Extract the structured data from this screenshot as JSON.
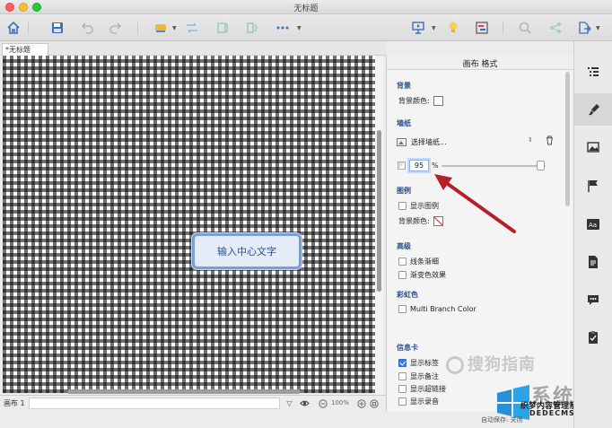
{
  "window": {
    "title": "无标题"
  },
  "tabs": [
    {
      "label": "*无标题"
    }
  ],
  "canvas": {
    "central_topic": "输入中心文字"
  },
  "status": {
    "sheet_label": "画布 1",
    "zoom": "100%"
  },
  "panel": {
    "title": "画布 格式",
    "background": {
      "section": "背景",
      "color_label": "背景颜色:"
    },
    "wallpaper": {
      "section": "墙纸",
      "select_label": "选择墙纸...",
      "opacity_value": "95",
      "opacity_unit": "%",
      "opacity_level": 0.95
    },
    "legend": {
      "section": "图例",
      "show_legend": "显示图例",
      "color_label": "背景颜色:"
    },
    "advanced": {
      "section": "高级",
      "taper_lines": "线条渐细",
      "gradient": "渐变色效果"
    },
    "rainbow": {
      "section": "彩虹色",
      "multi_branch": "Multi Branch Color"
    },
    "info_card": {
      "section": "信息卡",
      "show_labels": "显示标签",
      "show_notes": "显示备注",
      "show_hyperlinks": "显示超链接",
      "show_audio": "显示录音"
    }
  },
  "watermark": {
    "sogou": "搜狗指南",
    "site_cn": "系统城",
    "site_note": "织梦内容管理系统",
    "site_url": "DEDECMS.COM",
    "autosave": "自动保存: 关闭"
  },
  "colors": {
    "accent": "#3b7ddd",
    "section_title": "#2a4f8a",
    "topic_border": "#7a9fd8",
    "arrow": "#b3202a"
  }
}
